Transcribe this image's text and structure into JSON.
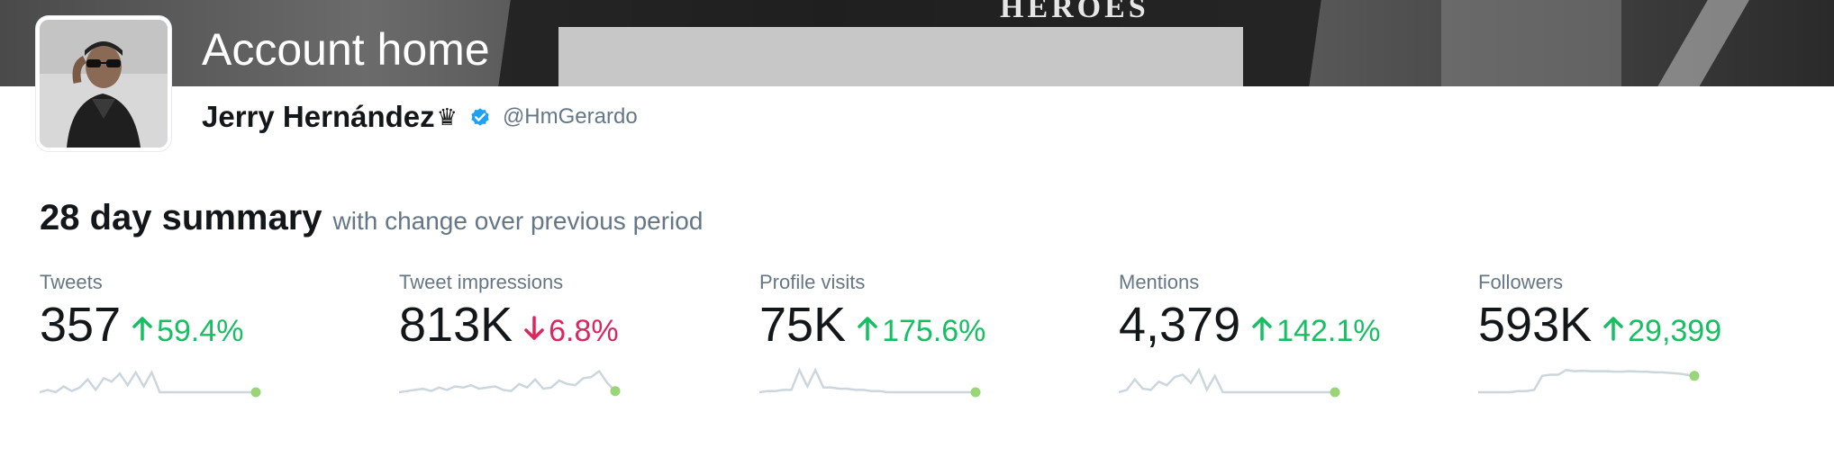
{
  "page": {
    "title": "Account home"
  },
  "profile": {
    "name": "Jerry Hernández",
    "name_suffix": "♛",
    "handle": "@HmGerardo",
    "verified": true
  },
  "banner": {
    "sign_text": "HEROES"
  },
  "summary": {
    "title": "28 day summary",
    "subtitle": "with change over previous period"
  },
  "colors": {
    "up": "#17bf63",
    "down": "#e0245e",
    "verified": "#1da1f2",
    "spark_line": "#ccd6dd",
    "spark_dot": "#9ad678"
  },
  "metrics": [
    {
      "label": "Tweets",
      "value": "357",
      "change": "59.4%",
      "direction": "up"
    },
    {
      "label": "Tweet impressions",
      "value": "813K",
      "change": "6.8%",
      "direction": "down"
    },
    {
      "label": "Profile visits",
      "value": "75K",
      "change": "175.6%",
      "direction": "up"
    },
    {
      "label": "Mentions",
      "value": "4,379",
      "change": "142.1%",
      "direction": "up"
    },
    {
      "label": "Followers",
      "value": "593K",
      "change": "29,399",
      "direction": "up"
    }
  ],
  "sparklines": [
    [
      0,
      0.1,
      0,
      0.25,
      0.05,
      0.2,
      0.55,
      0.1,
      0.6,
      0.45,
      0.8,
      0.3,
      0.85,
      0.25,
      0.85,
      0,
      0,
      0,
      0,
      0,
      0,
      0,
      0,
      0,
      0,
      0,
      0,
      0
    ],
    [
      0,
      0.05,
      0.1,
      0.15,
      0.05,
      0.2,
      0.1,
      0.25,
      0.2,
      0.3,
      0.15,
      0.2,
      0.25,
      0.1,
      0.05,
      0.35,
      0.2,
      0.55,
      0.15,
      0.2,
      0.5,
      0.35,
      0.3,
      0.6,
      0.65,
      0.9,
      0.4,
      0.05
    ],
    [
      0,
      0.05,
      0.05,
      0.1,
      0.1,
      0.95,
      0.25,
      0.95,
      0.2,
      0.2,
      0.15,
      0.15,
      0.1,
      0.1,
      0.05,
      0.05,
      0,
      0,
      0,
      0,
      0,
      0,
      0,
      0,
      0,
      0,
      0,
      0
    ],
    [
      0,
      0.1,
      0.55,
      0.15,
      0.1,
      0.45,
      0.3,
      0.65,
      0.75,
      0.4,
      0.95,
      0.1,
      0.7,
      0,
      0,
      0,
      0,
      0,
      0,
      0,
      0,
      0,
      0,
      0,
      0,
      0,
      0,
      0
    ],
    [
      0,
      0,
      0,
      0,
      0,
      0.05,
      0.05,
      0.1,
      0.7,
      0.75,
      0.75,
      0.95,
      0.9,
      0.92,
      0.9,
      0.9,
      0.9,
      0.88,
      0.88,
      0.9,
      0.88,
      0.88,
      0.85,
      0.85,
      0.82,
      0.8,
      0.75,
      0.7
    ]
  ]
}
